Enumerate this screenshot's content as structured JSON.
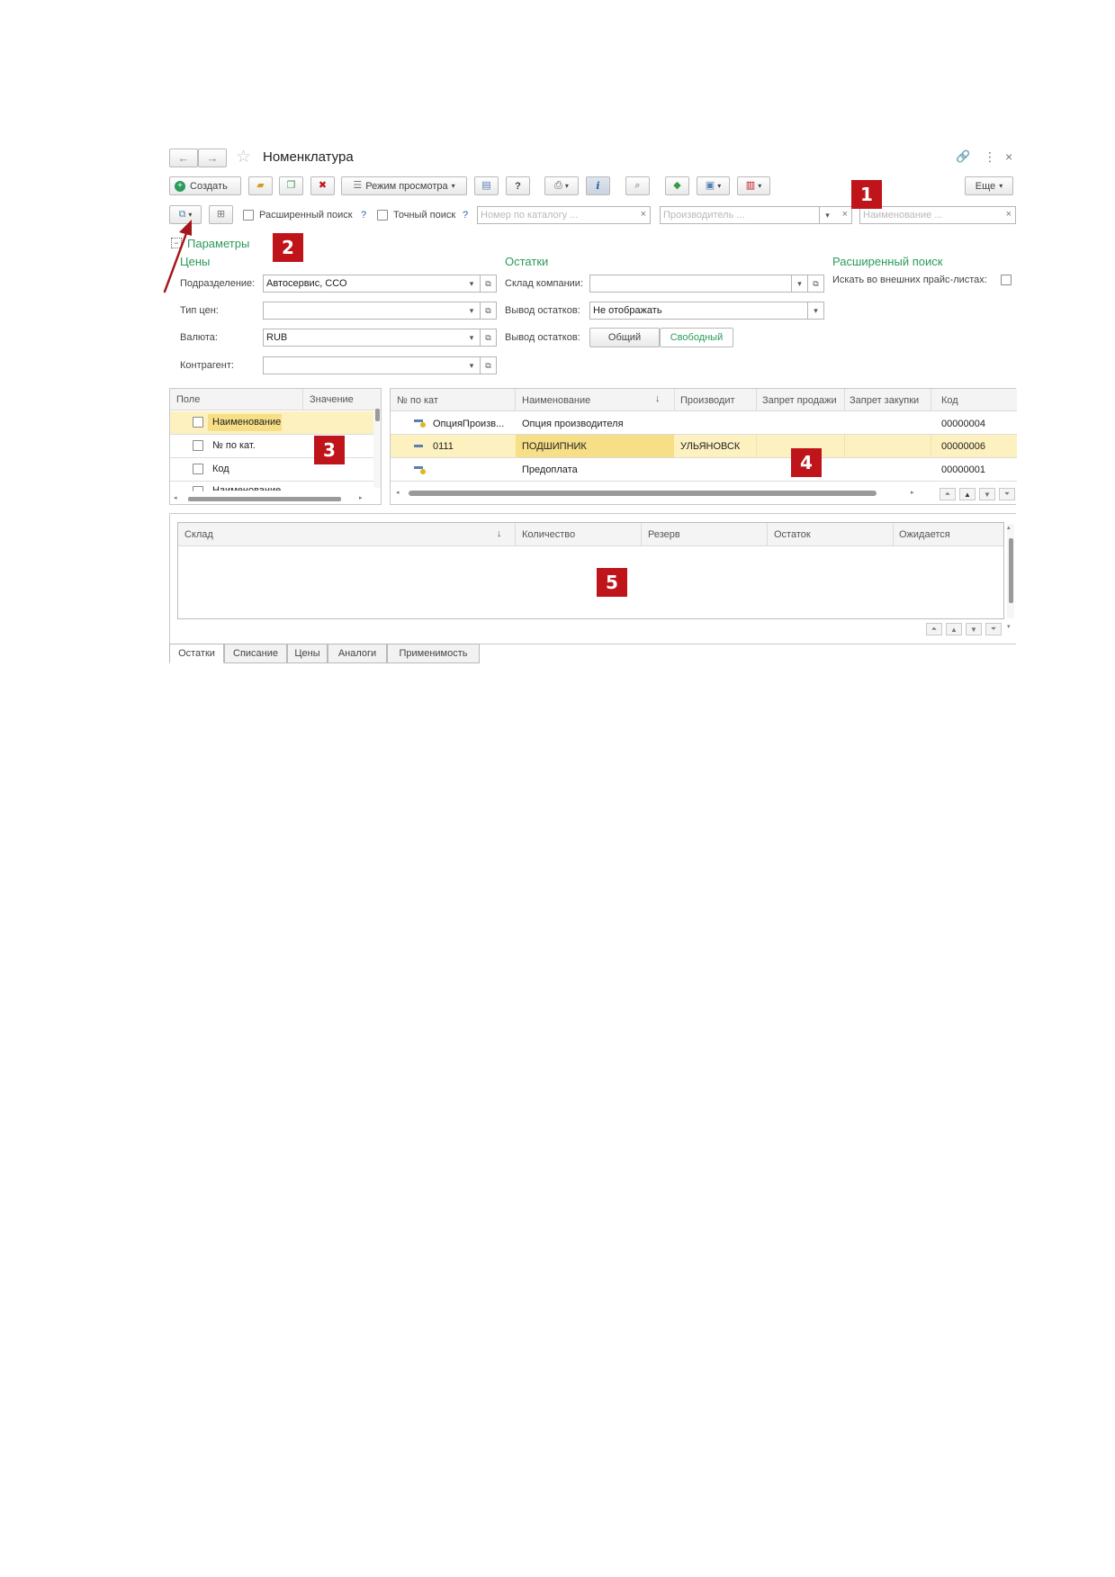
{
  "window": {
    "title": "Номенклатура"
  },
  "toolbar": {
    "create_label": "Создать",
    "view_mode_label": "Режим просмотра",
    "help_label": "?",
    "info_label": "i",
    "more_label": "Еще"
  },
  "search": {
    "extended_label": "Расширенный поиск",
    "extended_help": "?",
    "exact_label": "Точный поиск",
    "exact_help": "?",
    "catalog_placeholder": "Номер по каталогу ...",
    "manufacturer_placeholder": "Производитель ...",
    "name_placeholder": "Наименование ..."
  },
  "params": {
    "title": "Параметры",
    "prices_header": "Цены",
    "division_label": "Подразделение:",
    "division_value": "Автосервис, ССО",
    "price_type_label": "Тип цен:",
    "currency_label": "Валюта:",
    "currency_value": "RUB",
    "counterparty_label": "Контрагент:",
    "stock_header": "Остатки",
    "company_warehouse_label": "Склад компании:",
    "stock_output_label": "Вывод остатков:",
    "stock_output_value": "Не отображать",
    "stock_output2_label": "Вывод остатков:",
    "stock_mode_total": "Общий",
    "stock_mode_free": "Свободный",
    "extsearch_header": "Расширенный поиск",
    "external_price_label": "Искать во внешних прайс-листах:"
  },
  "fields_table": {
    "columns": [
      "Поле",
      "Значение"
    ],
    "rows": [
      {
        "name": "Наименование"
      },
      {
        "name": "№ по кат."
      },
      {
        "name": "Код"
      },
      {
        "name": "Наименование..."
      }
    ]
  },
  "items_table": {
    "columns": [
      "№ по кат",
      "Наименование",
      "Производит",
      "Запрет продажи",
      "Запрет закупки",
      "Код"
    ],
    "rows": [
      {
        "catalog": "ОпцияПроизв...",
        "name": "Опция производителя",
        "manufacturer": "",
        "code": "00000004"
      },
      {
        "catalog": "0111",
        "name": "ПОДШИПНИК",
        "manufacturer": "УЛЬЯНОВСК",
        "code": "00000006"
      },
      {
        "catalog": "",
        "name": "Предоплата",
        "manufacturer": "",
        "code": "00000001"
      }
    ]
  },
  "stock_table": {
    "columns": [
      "Склад",
      "Количество",
      "Резерв",
      "Остаток",
      "Ожидается"
    ]
  },
  "tabs": [
    "Остатки",
    "Списание",
    "Цены",
    "Аналоги",
    "Применимость"
  ],
  "markers": [
    "1",
    "2",
    "3",
    "4",
    "5"
  ],
  "colors": {
    "accent_green": "#2a9b58",
    "marker_red": "#c0141b",
    "selected_row": "#fdf1c0"
  }
}
